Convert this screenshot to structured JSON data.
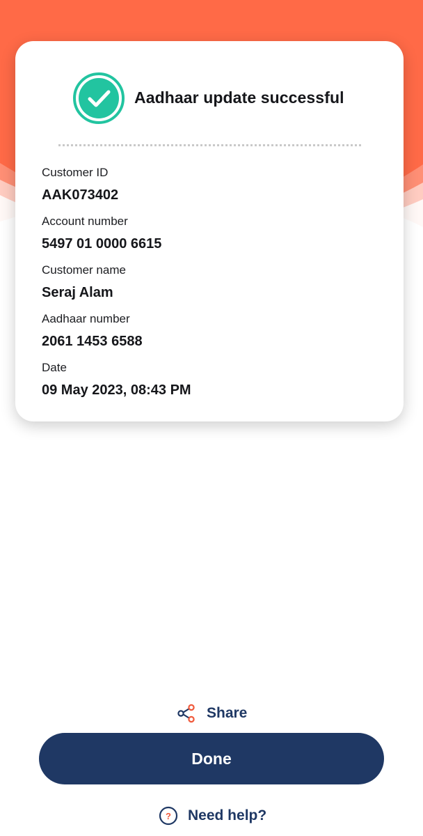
{
  "colors": {
    "header_orange": "#ff6a47",
    "success_green": "#22c4a0",
    "primary_navy": "#1f3864",
    "share_accent": "#f05a3c"
  },
  "status": {
    "icon": "check-circle-icon",
    "title": "Aadhaar update successful"
  },
  "details": {
    "customer_id": {
      "label": "Customer ID",
      "value": "AAK073402"
    },
    "account_number": {
      "label": "Account number",
      "value": "5497 01 0000 6615"
    },
    "customer_name": {
      "label": "Customer name",
      "value": "Seraj Alam"
    },
    "aadhaar_number": {
      "label": "Aadhaar number",
      "value": "2061 1453 6588"
    },
    "date": {
      "label": "Date",
      "value": "09 May 2023, 08:43 PM"
    }
  },
  "actions": {
    "share": {
      "label": "Share",
      "icon": "share-icon"
    },
    "done": {
      "label": "Done"
    },
    "help": {
      "label": "Need help?",
      "icon": "question-circle-icon"
    }
  }
}
